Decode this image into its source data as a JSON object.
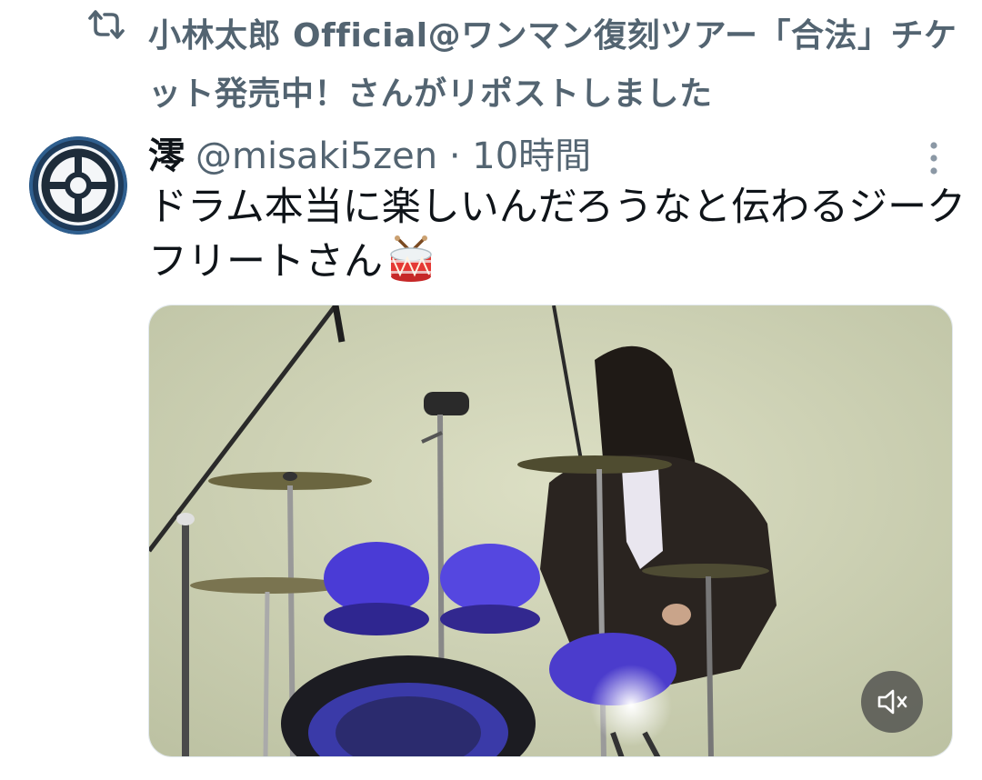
{
  "repost": {
    "text": "小林太郎 Official@ワンマン復刻ツアー「合法」チケット発売中！さんがリポストしました",
    "icon": "repost-icon"
  },
  "tweet": {
    "display_name": "澪",
    "handle": "@misaki5zen",
    "separator": "·",
    "time": "10時間",
    "text": "ドラム本当に楽しいんだろうなと伝わるジークフリートさん",
    "emoji": "drum-emoji",
    "more_icon": "more-vertical-icon"
  },
  "media": {
    "type": "video",
    "description_icon": "drum-kit-video",
    "mute_icon": "volume-muted-icon"
  },
  "colors": {
    "text_primary": "#0f1419",
    "text_secondary": "#536471",
    "background": "#ffffff"
  }
}
